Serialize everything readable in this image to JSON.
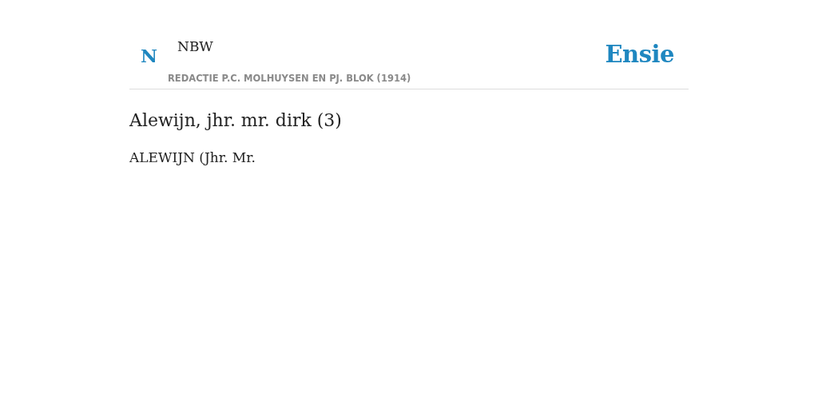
{
  "header": {
    "logo_letter": "N",
    "source_title": "NBW",
    "source_subtitle": "REDACTIE P.C. MOLHUYSEN EN PJ. BLOK (1914)",
    "brand": "Ensie"
  },
  "article": {
    "title": "Alewijn, jhr. mr. dirk (3)",
    "body": "ALEWIJN (Jhr. Mr."
  }
}
